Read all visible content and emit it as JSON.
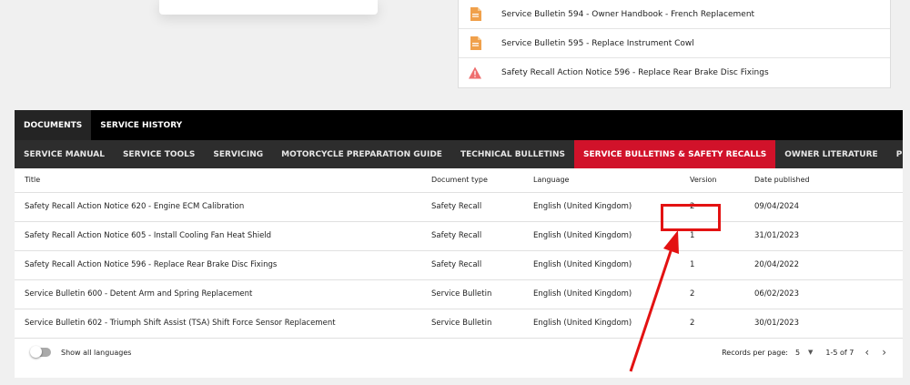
{
  "recent_docs": [
    {
      "icon": "document-icon",
      "title": "Service Bulletin 594 - Owner Handbook - French Replacement"
    },
    {
      "icon": "document-icon",
      "title": "Service Bulletin 595 - Replace Instrument Cowl"
    },
    {
      "icon": "warning-icon",
      "title": "Safety Recall Action Notice 596 - Replace Rear Brake Disc Fixings"
    }
  ],
  "tabs_top": [
    "DOCUMENTS",
    "SERVICE HISTORY"
  ],
  "tabs_sub": [
    "SERVICE MANUAL",
    "SERVICE TOOLS",
    "SERVICING",
    "MOTORCYCLE PREPARATION GUIDE",
    "TECHNICAL BULLETINS",
    "SERVICE BULLETINS & SAFETY RECALLS",
    "OWNER LITERATURE",
    "PERIODIC TECHNICAL INSPECTION"
  ],
  "table": {
    "headers": [
      "Title",
      "Document type",
      "Language",
      "Version",
      "Date published"
    ],
    "rows": [
      [
        "Safety Recall Action Notice 620 - Engine ECM Calibration",
        "Safety Recall",
        "English (United Kingdom)",
        "2",
        "09/04/2024"
      ],
      [
        "Safety Recall Action Notice 605 - Install Cooling Fan Heat Shield",
        "Safety Recall",
        "English (United Kingdom)",
        "1",
        "31/01/2023"
      ],
      [
        "Safety Recall Action Notice 596 - Replace Rear Brake Disc Fixings",
        "Safety Recall",
        "English (United Kingdom)",
        "1",
        "20/04/2022"
      ],
      [
        "Service Bulletin 600 - Detent Arm and Spring Replacement",
        "Service Bulletin",
        "English (United Kingdom)",
        "2",
        "06/02/2023"
      ],
      [
        "Service Bulletin 602 - Triumph Shift Assist (TSA) Shift Force Sensor Replacement",
        "Service Bulletin",
        "English (United Kingdom)",
        "2",
        "30/01/2023"
      ]
    ]
  },
  "footer": {
    "toggle_label": "Show all languages",
    "records_label": "Records per page:",
    "records_value": "5",
    "range": "1-5 of 7",
    "prev": "‹",
    "next": "›"
  },
  "colors": {
    "accent_red": "#d1122a",
    "annotation_red": "#e31212",
    "doc_icon_orange": "#f0a04b"
  }
}
